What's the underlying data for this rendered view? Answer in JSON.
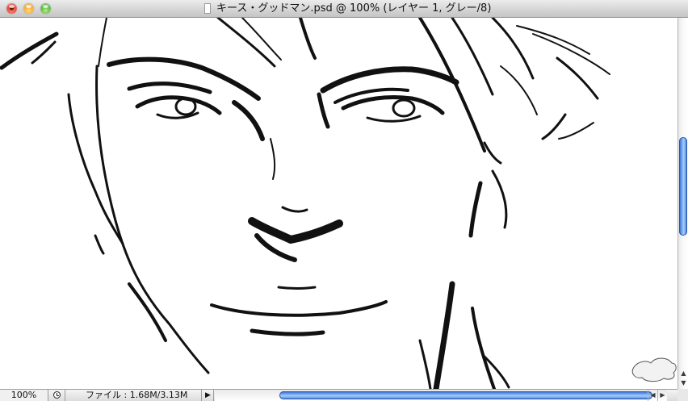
{
  "window": {
    "title": "キース・グッドマン.psd @ 100% (レイヤー 1, グレー/8)"
  },
  "status_bar": {
    "zoom": "100%",
    "file_info": "ファイル : 1.68M/3.13M",
    "info_menu_arrow": "▶"
  },
  "scroll_arrows": {
    "up": "▲",
    "down": "▼",
    "left": "◀",
    "right": "▶"
  },
  "scrollbars": {
    "vertical_position": 0.35,
    "horizontal_position": 0.5
  },
  "icons": {
    "close": "close-icon",
    "minimize": "minimize-icon",
    "zoom": "zoom-icon",
    "document": "document-icon",
    "clock": "clock-icon"
  },
  "colors": {
    "canvas": "#ffffff",
    "ink": "#111111",
    "scroll_thumb": "#4c86e0"
  }
}
